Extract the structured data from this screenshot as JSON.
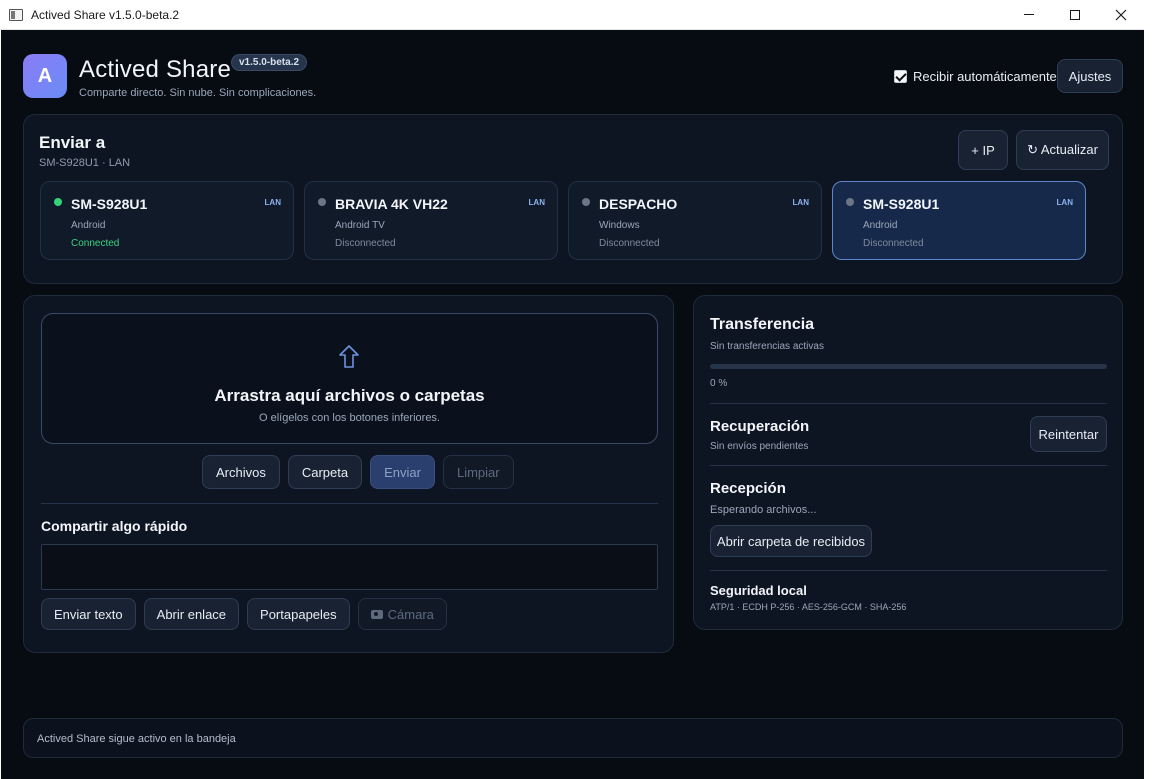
{
  "window": {
    "title": "Actived Share v1.5.0-beta.2"
  },
  "header": {
    "logo_letter": "A",
    "app_name": "Actived Share",
    "version": "v1.5.0-beta.2",
    "tagline": "Comparte directo. Sin nube. Sin complicaciones.",
    "auto_receive_label": "Recibir automáticamente",
    "auto_receive_checked": true,
    "settings_label": "Ajustes"
  },
  "send": {
    "title": "Enviar a",
    "subtitle": "SM-S928U1 · LAN",
    "add_ip_label": "+ IP",
    "refresh_label": "↻ Actualizar",
    "devices": [
      {
        "name": "SM-S928U1",
        "type": "Android",
        "status": "Connected",
        "network": "LAN",
        "connected": true,
        "selected": false
      },
      {
        "name": "BRAVIA 4K VH22",
        "type": "Android TV",
        "status": "Disconnected",
        "network": "LAN",
        "connected": false,
        "selected": false
      },
      {
        "name": "DESPACHO",
        "type": "Windows",
        "status": "Disconnected",
        "network": "LAN",
        "connected": false,
        "selected": false
      },
      {
        "name": "SM-S928U1",
        "type": "Android",
        "status": "Disconnected",
        "network": "LAN",
        "connected": false,
        "selected": true
      }
    ]
  },
  "dropzone": {
    "title": "Arrastra aquí archivos o carpetas",
    "subtitle": "O elígelos con los botones inferiores.",
    "files_label": "Archivos",
    "folder_label": "Carpeta",
    "send_label": "Enviar",
    "clear_label": "Limpiar"
  },
  "quick_share": {
    "title": "Compartir algo rápido",
    "input_value": "",
    "send_text_label": "Enviar texto",
    "open_link_label": "Abrir enlace",
    "clipboard_label": "Portapapeles",
    "camera_label": "Cámara"
  },
  "transfer": {
    "title": "Transferencia",
    "subtitle": "Sin transferencias activas",
    "progress_percent": 0,
    "progress_text": "0 %"
  },
  "recovery": {
    "title": "Recuperación",
    "subtitle": "Sin envíos pendientes",
    "retry_label": "Reintentar"
  },
  "reception": {
    "title": "Recepción",
    "subtitle": "Esperando archivos...",
    "open_folder_label": "Abrir carpeta de recibidos"
  },
  "security": {
    "title": "Seguridad local",
    "details": "ATP/1 · ECDH P-256 · AES-256-GCM · SHA-256"
  },
  "footer": {
    "text": "Actived Share sigue activo en la bandeja"
  },
  "colors": {
    "background": "#070b12",
    "panel": "#0e1522",
    "accent": "#5f86c8",
    "connected": "#34d27a"
  }
}
